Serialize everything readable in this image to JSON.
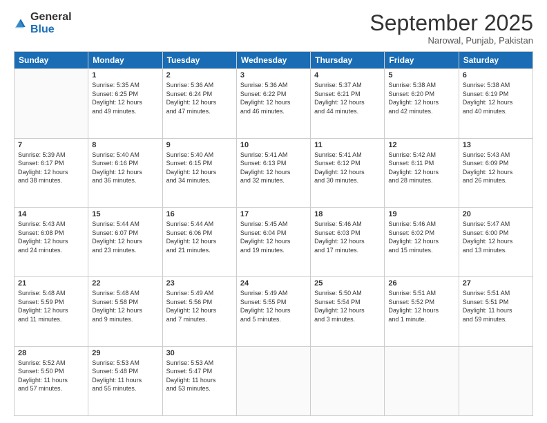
{
  "logo": {
    "general": "General",
    "blue": "Blue"
  },
  "header": {
    "month": "September 2025",
    "location": "Narowal, Punjab, Pakistan"
  },
  "days_of_week": [
    "Sunday",
    "Monday",
    "Tuesday",
    "Wednesday",
    "Thursday",
    "Friday",
    "Saturday"
  ],
  "weeks": [
    [
      {
        "day": "",
        "info": ""
      },
      {
        "day": "1",
        "info": "Sunrise: 5:35 AM\nSunset: 6:25 PM\nDaylight: 12 hours\nand 49 minutes."
      },
      {
        "day": "2",
        "info": "Sunrise: 5:36 AM\nSunset: 6:24 PM\nDaylight: 12 hours\nand 47 minutes."
      },
      {
        "day": "3",
        "info": "Sunrise: 5:36 AM\nSunset: 6:22 PM\nDaylight: 12 hours\nand 46 minutes."
      },
      {
        "day": "4",
        "info": "Sunrise: 5:37 AM\nSunset: 6:21 PM\nDaylight: 12 hours\nand 44 minutes."
      },
      {
        "day": "5",
        "info": "Sunrise: 5:38 AM\nSunset: 6:20 PM\nDaylight: 12 hours\nand 42 minutes."
      },
      {
        "day": "6",
        "info": "Sunrise: 5:38 AM\nSunset: 6:19 PM\nDaylight: 12 hours\nand 40 minutes."
      }
    ],
    [
      {
        "day": "7",
        "info": "Sunrise: 5:39 AM\nSunset: 6:17 PM\nDaylight: 12 hours\nand 38 minutes."
      },
      {
        "day": "8",
        "info": "Sunrise: 5:40 AM\nSunset: 6:16 PM\nDaylight: 12 hours\nand 36 minutes."
      },
      {
        "day": "9",
        "info": "Sunrise: 5:40 AM\nSunset: 6:15 PM\nDaylight: 12 hours\nand 34 minutes."
      },
      {
        "day": "10",
        "info": "Sunrise: 5:41 AM\nSunset: 6:13 PM\nDaylight: 12 hours\nand 32 minutes."
      },
      {
        "day": "11",
        "info": "Sunrise: 5:41 AM\nSunset: 6:12 PM\nDaylight: 12 hours\nand 30 minutes."
      },
      {
        "day": "12",
        "info": "Sunrise: 5:42 AM\nSunset: 6:11 PM\nDaylight: 12 hours\nand 28 minutes."
      },
      {
        "day": "13",
        "info": "Sunrise: 5:43 AM\nSunset: 6:09 PM\nDaylight: 12 hours\nand 26 minutes."
      }
    ],
    [
      {
        "day": "14",
        "info": "Sunrise: 5:43 AM\nSunset: 6:08 PM\nDaylight: 12 hours\nand 24 minutes."
      },
      {
        "day": "15",
        "info": "Sunrise: 5:44 AM\nSunset: 6:07 PM\nDaylight: 12 hours\nand 23 minutes."
      },
      {
        "day": "16",
        "info": "Sunrise: 5:44 AM\nSunset: 6:06 PM\nDaylight: 12 hours\nand 21 minutes."
      },
      {
        "day": "17",
        "info": "Sunrise: 5:45 AM\nSunset: 6:04 PM\nDaylight: 12 hours\nand 19 minutes."
      },
      {
        "day": "18",
        "info": "Sunrise: 5:46 AM\nSunset: 6:03 PM\nDaylight: 12 hours\nand 17 minutes."
      },
      {
        "day": "19",
        "info": "Sunrise: 5:46 AM\nSunset: 6:02 PM\nDaylight: 12 hours\nand 15 minutes."
      },
      {
        "day": "20",
        "info": "Sunrise: 5:47 AM\nSunset: 6:00 PM\nDaylight: 12 hours\nand 13 minutes."
      }
    ],
    [
      {
        "day": "21",
        "info": "Sunrise: 5:48 AM\nSunset: 5:59 PM\nDaylight: 12 hours\nand 11 minutes."
      },
      {
        "day": "22",
        "info": "Sunrise: 5:48 AM\nSunset: 5:58 PM\nDaylight: 12 hours\nand 9 minutes."
      },
      {
        "day": "23",
        "info": "Sunrise: 5:49 AM\nSunset: 5:56 PM\nDaylight: 12 hours\nand 7 minutes."
      },
      {
        "day": "24",
        "info": "Sunrise: 5:49 AM\nSunset: 5:55 PM\nDaylight: 12 hours\nand 5 minutes."
      },
      {
        "day": "25",
        "info": "Sunrise: 5:50 AM\nSunset: 5:54 PM\nDaylight: 12 hours\nand 3 minutes."
      },
      {
        "day": "26",
        "info": "Sunrise: 5:51 AM\nSunset: 5:52 PM\nDaylight: 12 hours\nand 1 minute."
      },
      {
        "day": "27",
        "info": "Sunrise: 5:51 AM\nSunset: 5:51 PM\nDaylight: 11 hours\nand 59 minutes."
      }
    ],
    [
      {
        "day": "28",
        "info": "Sunrise: 5:52 AM\nSunset: 5:50 PM\nDaylight: 11 hours\nand 57 minutes."
      },
      {
        "day": "29",
        "info": "Sunrise: 5:53 AM\nSunset: 5:48 PM\nDaylight: 11 hours\nand 55 minutes."
      },
      {
        "day": "30",
        "info": "Sunrise: 5:53 AM\nSunset: 5:47 PM\nDaylight: 11 hours\nand 53 minutes."
      },
      {
        "day": "",
        "info": ""
      },
      {
        "day": "",
        "info": ""
      },
      {
        "day": "",
        "info": ""
      },
      {
        "day": "",
        "info": ""
      }
    ]
  ]
}
